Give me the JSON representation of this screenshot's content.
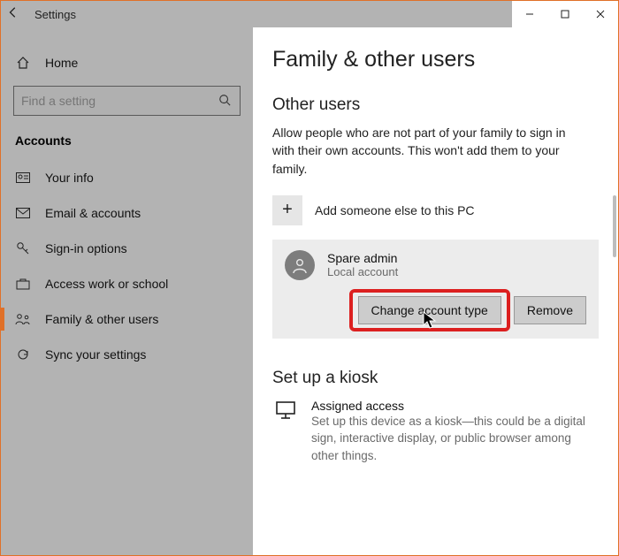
{
  "window": {
    "title": "Settings"
  },
  "sidebar": {
    "home": "Home",
    "search_placeholder": "Find a setting",
    "section": "Accounts",
    "items": [
      {
        "label": "Your info"
      },
      {
        "label": "Email & accounts"
      },
      {
        "label": "Sign-in options"
      },
      {
        "label": "Access work or school"
      },
      {
        "label": "Family & other users"
      },
      {
        "label": "Sync your settings"
      }
    ]
  },
  "main": {
    "title": "Family & other users",
    "other_users_header": "Other users",
    "other_users_desc": "Allow people who are not part of your family to sign in with their own accounts. This won't add them to your family.",
    "add_label": "Add someone else to this PC",
    "user": {
      "name": "Spare admin",
      "type": "Local account",
      "change_btn": "Change account type",
      "remove_btn": "Remove"
    },
    "kiosk_header": "Set up a kiosk",
    "kiosk_title": "Assigned access",
    "kiosk_desc": "Set up this device as a kiosk—this could be a digital sign, interactive display, or public browser among other things."
  }
}
